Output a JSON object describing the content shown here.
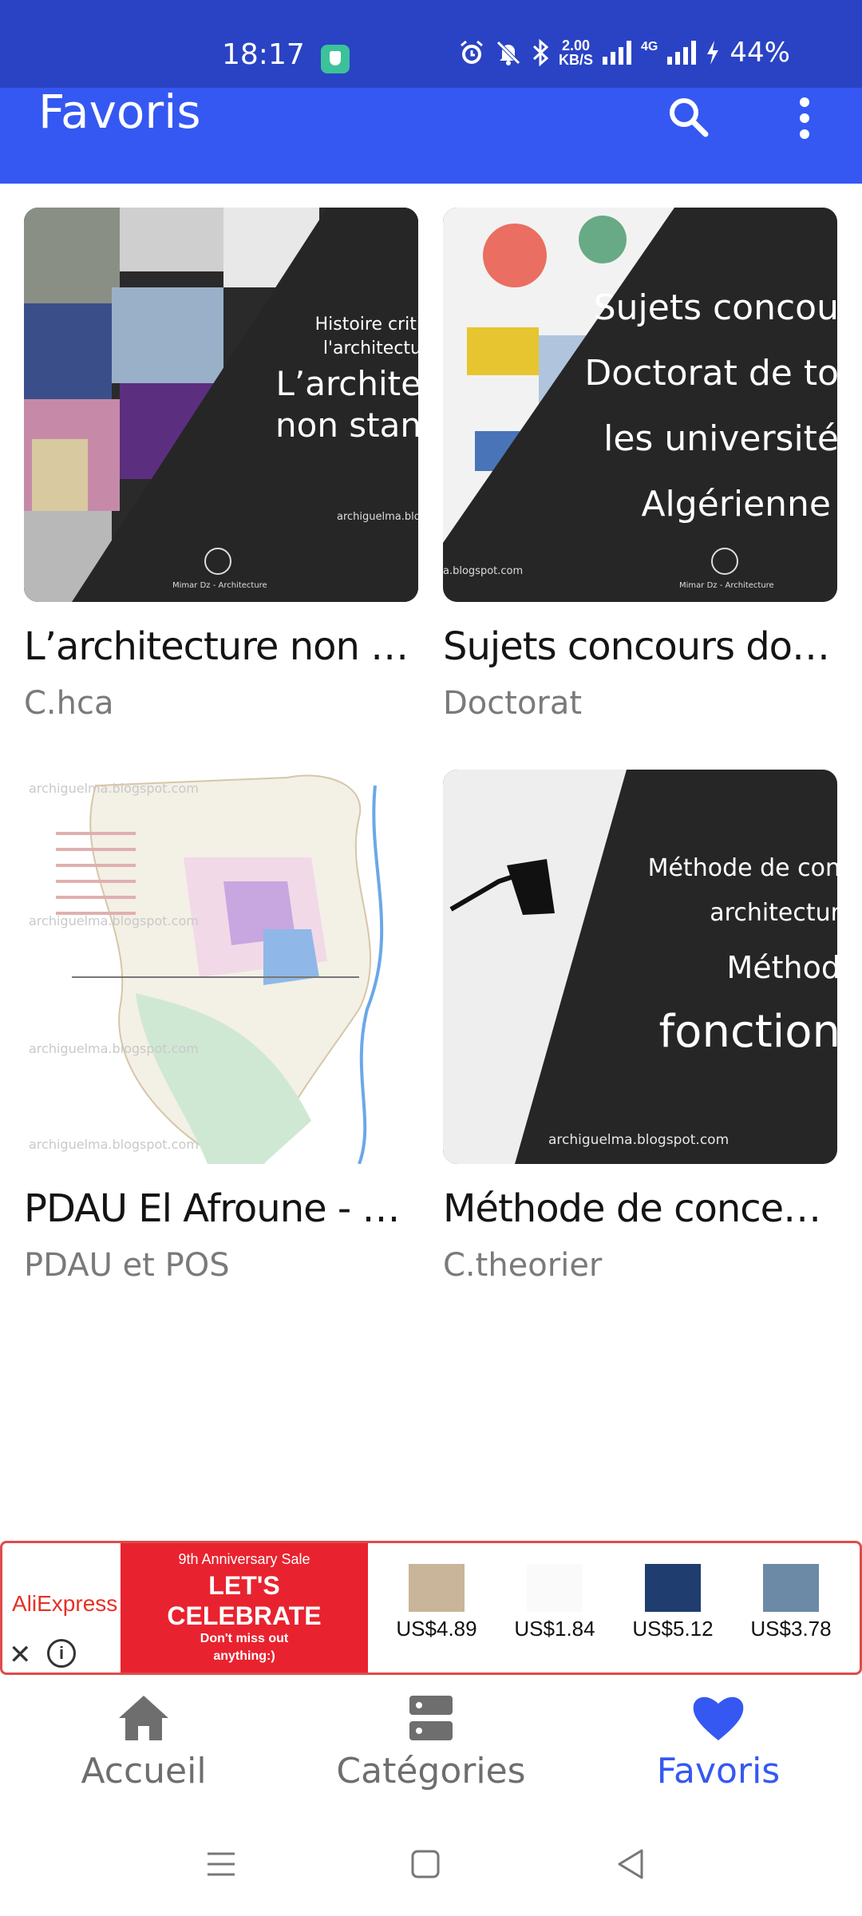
{
  "status_bar": {
    "time": "18:17",
    "net_speed_value": "2.00",
    "net_speed_unit": "KB/S",
    "network_type": "4G",
    "battery": "44%",
    "icons": [
      "shield-icon",
      "alarm-icon",
      "mute-icon",
      "bluetooth-icon",
      "signal-icon",
      "charging-icon"
    ]
  },
  "app_bar": {
    "title": "Favoris",
    "color": "#3558f2",
    "actions": [
      "search-icon",
      "more-vert-icon"
    ]
  },
  "favorites": [
    {
      "title": "L’architecture non …",
      "category": "C.hca",
      "thumb_lines": [
        "Histoire criti",
        "l'architectu",
        "L’archite",
        "non stan"
      ],
      "thumb_footer": "archiguelma.blogspot",
      "thumb_caption": "Mimar Dz - Architecture"
    },
    {
      "title": "Sujets concours do…",
      "category": "Doctorat",
      "thumb_lines": [
        "Sujets concou",
        "Doctorat de to",
        "les université",
        "Algérienne"
      ],
      "thumb_footer": "a.blogspot.com",
      "thumb_caption": "Mimar Dz - Architecture"
    },
    {
      "title": "PDAU El Afroune - L…",
      "category": "PDAU et POS",
      "thumb_watermark": "archiguelma.blogspot.com"
    },
    {
      "title": "Méthode de conce…",
      "category": "C.theorier",
      "thumb_lines": [
        "Méthode de con",
        "architectur",
        "Méthod",
        "fonction"
      ],
      "thumb_footer": "archiguelma.blogspot.com"
    }
  ],
  "ad": {
    "brand": "AliExpress",
    "promo_sub": "9th Anniversary Sale",
    "promo_main_1": "LET'S",
    "promo_main_2": "CELEBRATE",
    "promo_note_1": "Don't miss out",
    "promo_note_2": "anything:)",
    "products": [
      {
        "price": "US$4.89"
      },
      {
        "price": "US$1.84"
      },
      {
        "price": "US$5.12"
      },
      {
        "price": "US$3.78"
      }
    ]
  },
  "bottom_nav": {
    "items": [
      {
        "label": "Accueil",
        "icon": "home-icon",
        "active": false
      },
      {
        "label": "Catégories",
        "icon": "categories-icon",
        "active": false
      },
      {
        "label": "Favoris",
        "icon": "heart-icon",
        "active": true
      }
    ],
    "active_color": "#3558f2",
    "inactive_color": "#6e6e6e"
  },
  "system_nav": [
    "recents-icon",
    "home-square-icon",
    "back-icon"
  ]
}
